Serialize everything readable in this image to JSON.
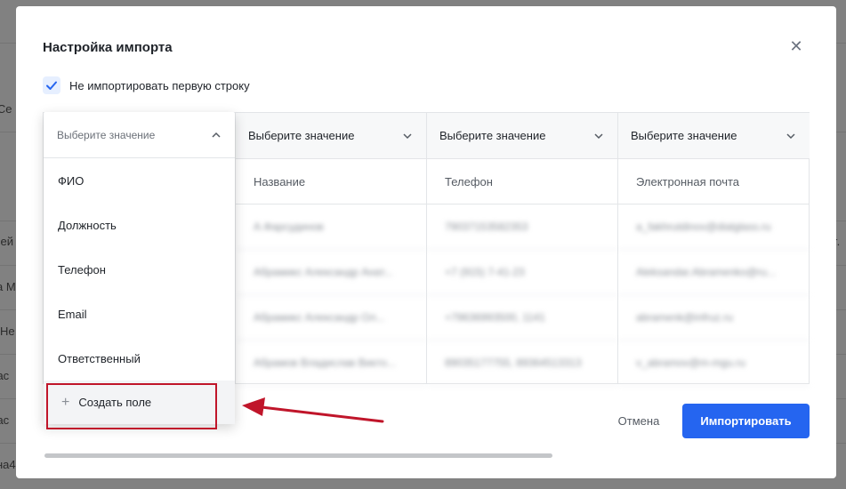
{
  "background": {
    "fragments": [
      "а Се",
      "сей",
      "а М",
      "Не",
      "гас",
      "гас",
      "на4",
      "r."
    ]
  },
  "modal": {
    "title": "Настройка импорта",
    "close_icon": "close-icon",
    "checkbox": {
      "label": "Не импортировать первую строку",
      "checked": true
    }
  },
  "table": {
    "columns": [
      {
        "select_label": "Выберите значение",
        "header": ""
      },
      {
        "select_label": "Выберите значение",
        "header": "Название"
      },
      {
        "select_label": "Выберите значение",
        "header": "Телефон"
      },
      {
        "select_label": "Выберите значение",
        "header": "Электронная почта"
      }
    ],
    "rows": [
      [
        "А.Фарсудинов",
        "79037153582353",
        "a_fakhrutdinov@dialglass.ru"
      ],
      [
        "Абрамикс Александр Анат...",
        "+7 (915) 7-41-23",
        "Aleksandar.Abramenko@ru..."
      ],
      [
        "Абрамикс Александр Ол...",
        "+79636993500, 1141",
        "abramenk@infruz.ru"
      ],
      [
        "Абрамов Владислав Викто...",
        "89035177755, 89364513313",
        "v_abramov@m-mgu.ru"
      ]
    ]
  },
  "dropdown": {
    "placeholder": "Выберите значение",
    "options": [
      "ФИО",
      "Должность",
      "Телефон",
      "Email",
      "Ответственный"
    ],
    "create_label": "Создать поле"
  },
  "footer": {
    "cancel_label": "Отмена",
    "import_label": "Импортировать"
  },
  "colors": {
    "primary": "#2565f0",
    "highlight": "#c0152a"
  }
}
